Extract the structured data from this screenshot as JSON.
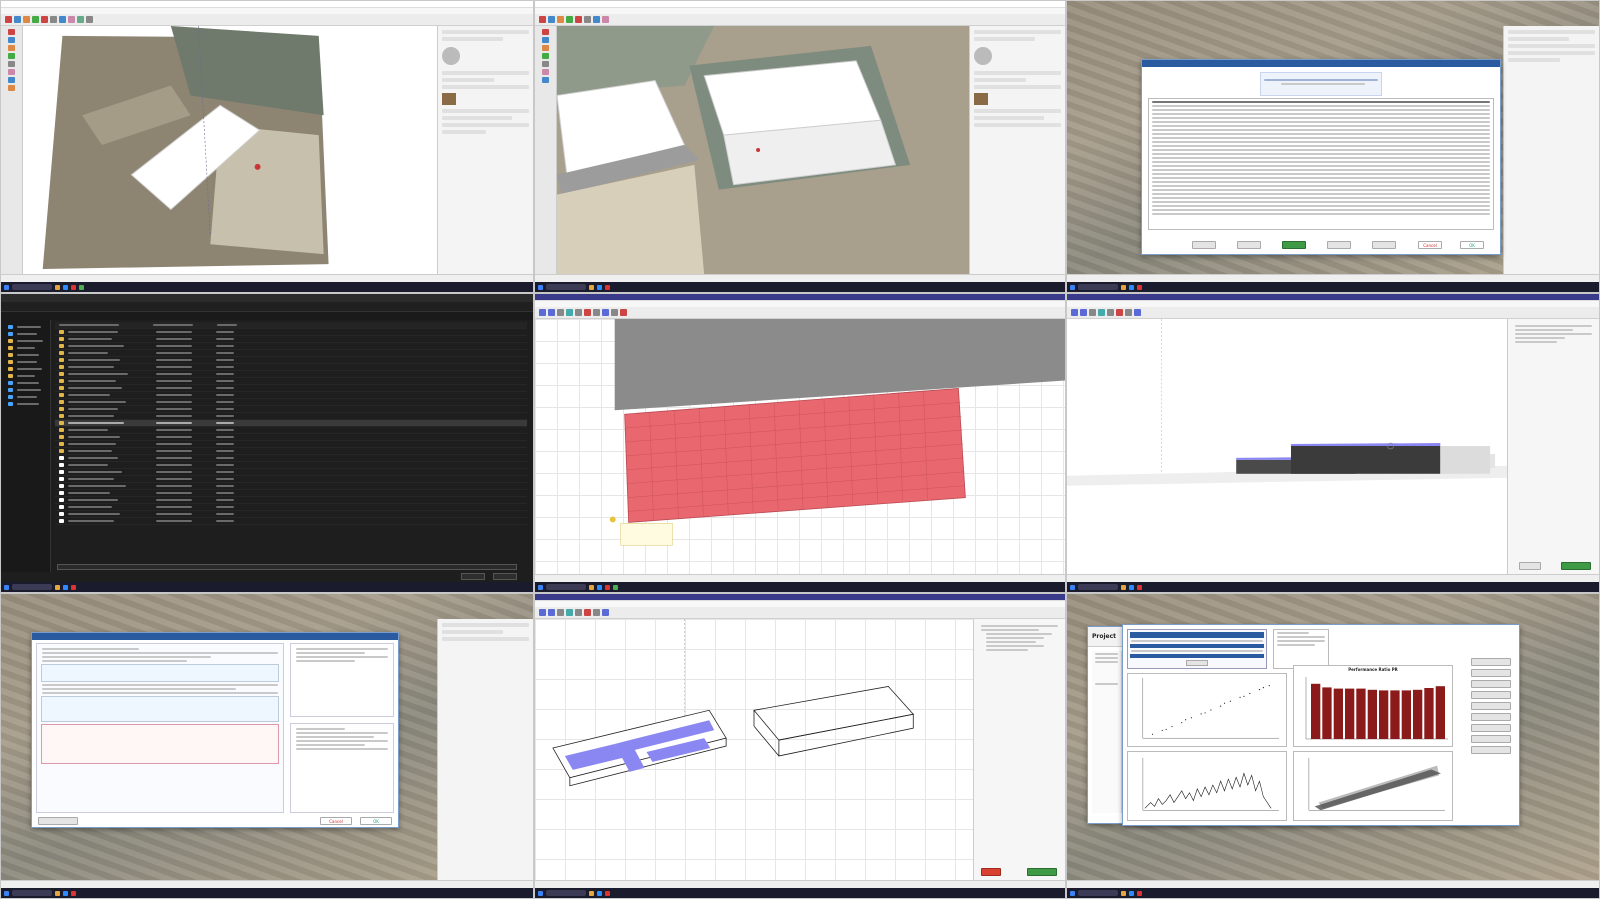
{
  "tiles": [
    {
      "id": "t1",
      "app": "sketchup"
    },
    {
      "id": "t2",
      "app": "sketchup"
    },
    {
      "id": "t3",
      "app": "sketchup",
      "dialog_buttons": {
        "cancel": "Cancel",
        "ok": "OK"
      }
    },
    {
      "id": "t4",
      "app": "file-explorer"
    },
    {
      "id": "t5",
      "app": "pvsyst-3d"
    },
    {
      "id": "t6",
      "app": "pvsyst-3d"
    },
    {
      "id": "t7",
      "app": "pvsyst-system",
      "dialog_buttons": {
        "cancel": "Cancel",
        "ok": "OK"
      }
    },
    {
      "id": "t8",
      "app": "pvsyst-3d"
    },
    {
      "id": "t9",
      "app": "pvsyst-results",
      "project_label": "Project",
      "charts": {
        "performance_ratio": {
          "title": "Performance Ratio PR",
          "values": [
            0.92,
            0.86,
            0.84,
            0.84,
            0.84,
            0.82,
            0.81,
            0.81,
            0.81,
            0.82,
            0.85,
            0.88
          ]
        }
      }
    }
  ],
  "colors": {
    "pv_red": "#e9676f",
    "pv_blue": "#8a87f2",
    "dialog_blue": "#2a5aa0",
    "bar_red": "#8b1a1a"
  }
}
